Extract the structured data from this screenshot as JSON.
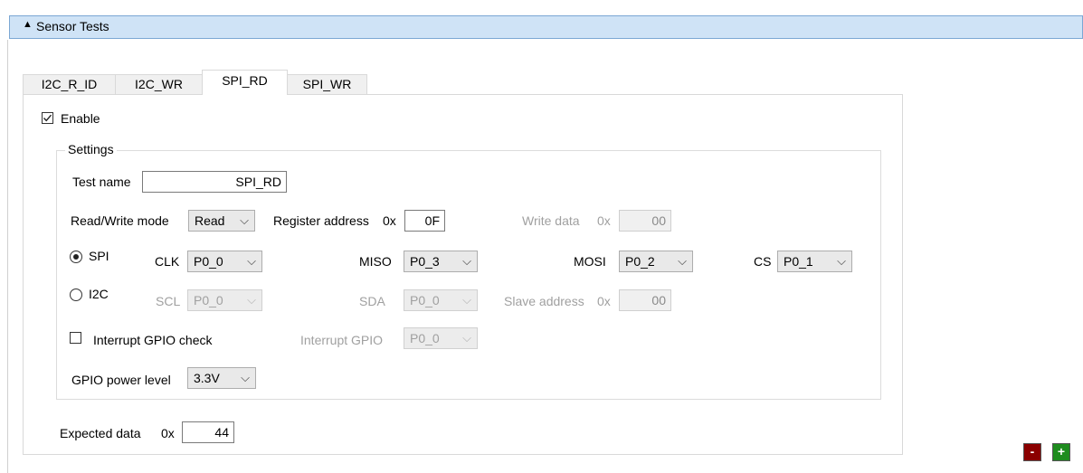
{
  "header": {
    "arrow": "▲",
    "title": "Sensor Tests"
  },
  "tabs": [
    {
      "label": "I2C_R_ID"
    },
    {
      "label": "I2C_WR"
    },
    {
      "label": "SPI_RD"
    },
    {
      "label": "SPI_WR"
    }
  ],
  "active_tab": "SPI_RD",
  "enable": {
    "label": "Enable",
    "checked": true
  },
  "settings": {
    "group_label": "Settings",
    "test_name_label": "Test name",
    "test_name_value": "SPI_RD",
    "rw_mode_label": "Read/Write mode",
    "rw_mode_value": "Read",
    "register_address_label": "Register address",
    "register_address_prefix": "0x",
    "register_address_value": "0F",
    "write_data_label": "Write data",
    "write_data_prefix": "0x",
    "write_data_value": "00",
    "spi_label": "SPI",
    "i2c_label": "I2C",
    "selected_bus": "SPI",
    "clk_label": "CLK",
    "clk_value": "P0_0",
    "miso_label": "MISO",
    "miso_value": "P0_3",
    "mosi_label": "MOSI",
    "mosi_value": "P0_2",
    "cs_label": "CS",
    "cs_value": "P0_1",
    "scl_label": "SCL",
    "scl_value": "P0_0",
    "sda_label": "SDA",
    "sda_value": "P0_0",
    "slave_address_label": "Slave address",
    "slave_address_prefix": "0x",
    "slave_address_value": "00",
    "interrupt_check_label": "Interrupt GPIO check",
    "interrupt_check_checked": false,
    "interrupt_gpio_label": "Interrupt GPIO",
    "interrupt_gpio_value": "P0_0",
    "gpio_power_label": "GPIO power level",
    "gpio_power_value": "3.3V"
  },
  "expected": {
    "label": "Expected data",
    "prefix": "0x",
    "value": "44"
  },
  "buttons": {
    "remove_label": "-",
    "add_label": "+"
  },
  "icons": {
    "dropdown": "chevron-down-icon",
    "checkmark": "checkmark-icon"
  },
  "colors": {
    "header_bg": "#cfe3f6",
    "header_border": "#7ba7d4",
    "remove_bg": "#8b0000",
    "add_bg": "#1e8c1e"
  }
}
